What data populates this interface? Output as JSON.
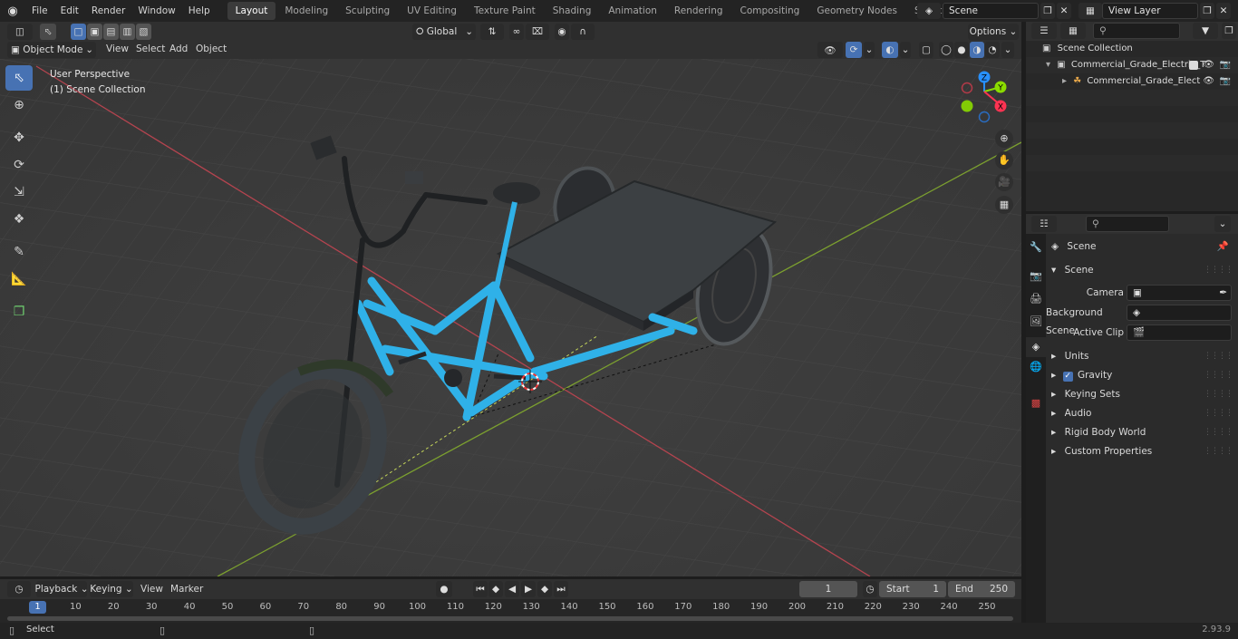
{
  "topbar": {
    "menus": [
      "File",
      "Edit",
      "Render",
      "Window",
      "Help"
    ],
    "workspaces": [
      "Layout",
      "Modeling",
      "Sculpting",
      "UV Editing",
      "Texture Paint",
      "Shading",
      "Animation",
      "Rendering",
      "Compositing",
      "Geometry Nodes",
      "Scripting"
    ],
    "add_tab": "+",
    "scene_name": "Scene",
    "view_layer": "View Layer"
  },
  "viewport_header": {
    "transform_orientation": "Global",
    "options_label": "Options",
    "mode": "Object Mode",
    "menus": [
      "View",
      "Select",
      "Add",
      "Object"
    ]
  },
  "viewport": {
    "perspective_label": "User Perspective",
    "collection_label": "(1) Scene Collection",
    "gizmo_axes": {
      "x": "X",
      "y": "Y",
      "z": "Z"
    }
  },
  "outliner": {
    "search_placeholder": "",
    "rows": [
      {
        "label": "Scene Collection"
      },
      {
        "label": "Commercial_Grade_Electric_T"
      },
      {
        "label": "Commercial_Grade_Elect"
      }
    ]
  },
  "properties": {
    "context_title": "Scene",
    "panel_title": "Scene",
    "camera_label": "Camera",
    "background_scene_label": "Background Scene",
    "active_clip_label": "Active Clip",
    "panels": [
      "Units",
      "Gravity",
      "Keying Sets",
      "Audio",
      "Rigid Body World",
      "Custom Properties"
    ],
    "gravity_checked": true
  },
  "timeline": {
    "menus": [
      "Playback",
      "Keying",
      "View",
      "Marker"
    ],
    "current_frame": "1",
    "start_label": "Start",
    "start_value": "1",
    "end_label": "End",
    "end_value": "250",
    "ruler_ticks": [
      "10",
      "20",
      "30",
      "40",
      "50",
      "60",
      "70",
      "80",
      "90",
      "100",
      "110",
      "120",
      "130",
      "140",
      "150",
      "160",
      "170",
      "180",
      "190",
      "200",
      "210",
      "220",
      "230",
      "240",
      "250"
    ],
    "playhead_label": "1"
  },
  "status": {
    "select_label": "Select",
    "version": "2.93.9"
  },
  "colors": {
    "accent": "#4772b3",
    "x_axis": "#ff3352",
    "y_axis": "#8bdc00",
    "z_axis": "#2890ff",
    "bike_frame": "#2fb1e8"
  }
}
